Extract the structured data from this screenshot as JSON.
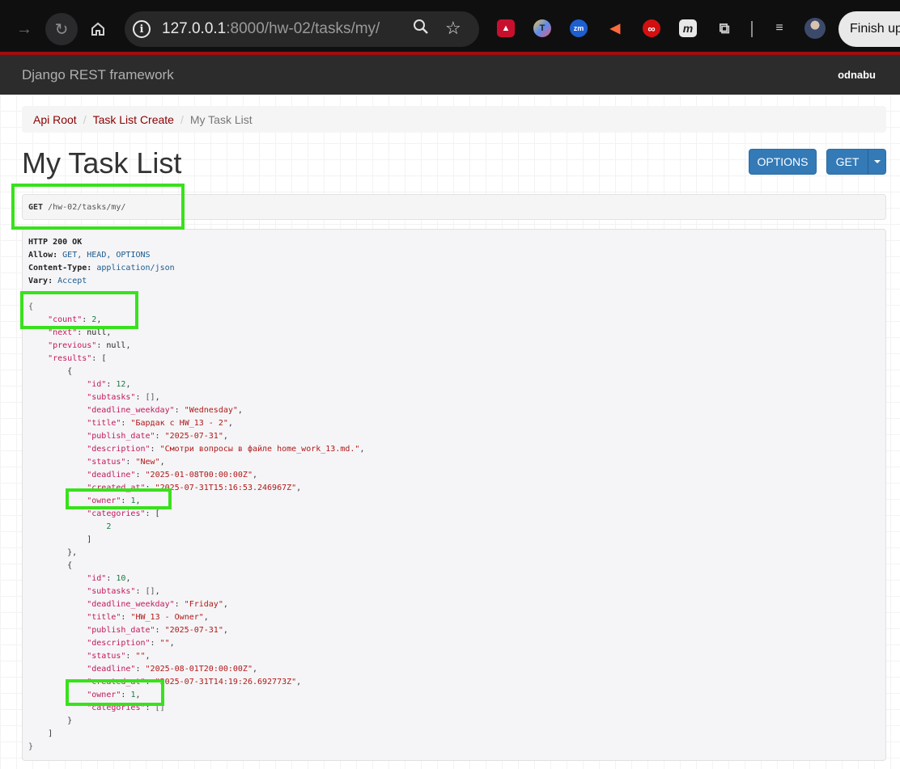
{
  "browser": {
    "url_host": "127.0.0.1",
    "url_path": ":8000/hw-02/tasks/my/",
    "finish_label": "Finish upd",
    "extension_icons": [
      "mendeley-icon",
      "tp-icon",
      "zoom-icon",
      "megaphone-icon",
      "infinity-icon",
      "m-icon",
      "puzzle-icon",
      "media-icon"
    ]
  },
  "navbar": {
    "brand": "Django REST framework",
    "user": "odnabu"
  },
  "breadcrumb": {
    "items": [
      "Api Root",
      "Task List Create"
    ],
    "active": "My Task List",
    "divider": "/"
  },
  "title": "My Task List",
  "buttons": {
    "options": "OPTIONS",
    "get": "GET"
  },
  "request": {
    "method": "GET",
    "path": "/hw-02/tasks/my/"
  },
  "response": {
    "status_line": "HTTP 200 OK",
    "headers": [
      {
        "key": "Allow:",
        "value": "GET, HEAD, OPTIONS"
      },
      {
        "key": "Content-Type:",
        "value": "application/json"
      },
      {
        "key": "Vary:",
        "value": "Accept"
      }
    ],
    "count": 2,
    "next": "null",
    "previous": "null",
    "results": [
      {
        "id": 12,
        "subtasks": "[]",
        "deadline_weekday": "Wednesday",
        "title": "Бардак с HW_13 - 2",
        "publish_date": "2025-07-31",
        "description": "Смотри вопросы в файле home_work_13.md.",
        "status": "New",
        "deadline": "2025-01-08T00:00:00Z",
        "created_at": "2025-07-31T15:16:53.246967Z",
        "owner": 1,
        "categories": [
          2
        ]
      },
      {
        "id": 10,
        "subtasks": "[]",
        "deadline_weekday": "Friday",
        "title": "HW_13 - Owner",
        "publish_date": "2025-07-31",
        "description": "",
        "status": "",
        "deadline": "2025-08-01T20:00:00Z",
        "created_at": "2025-07-31T14:19:26.692773Z",
        "owner": 1,
        "categories": "[]"
      }
    ]
  },
  "colors": {
    "highlight": "#39e11d",
    "navbar": "#2c2c2c",
    "button": "#337ab7",
    "link": "#8b0000"
  }
}
